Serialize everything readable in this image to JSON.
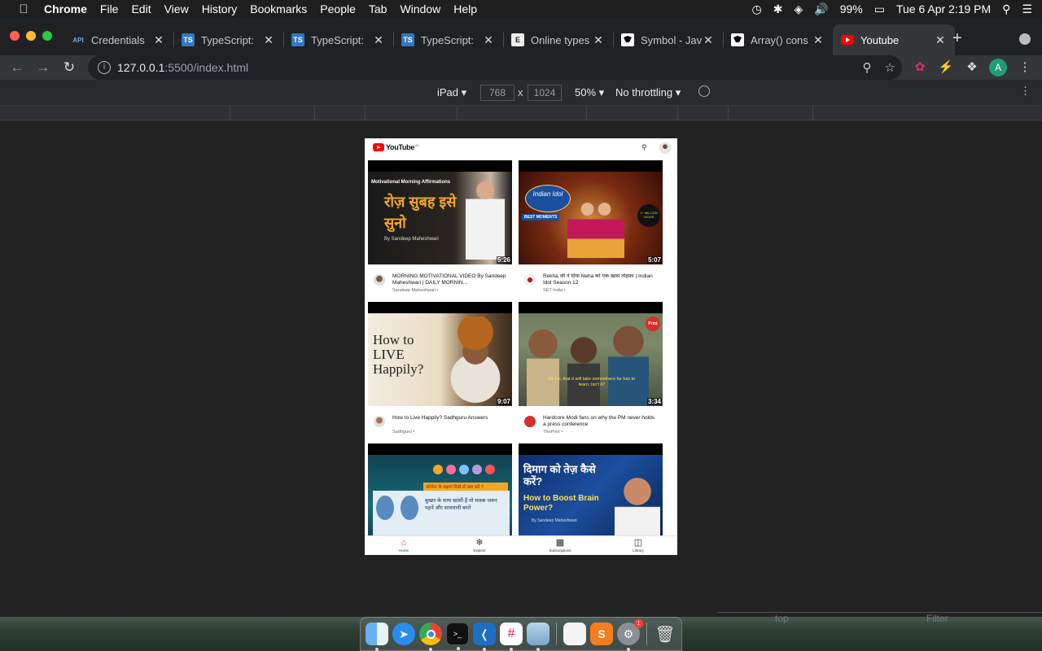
{
  "menubar": {
    "app": "Chrome",
    "items": [
      "File",
      "Edit",
      "View",
      "History",
      "Bookmarks",
      "People",
      "Tab",
      "Window",
      "Help"
    ],
    "battery": "99%",
    "datetime": "Tue 6 Apr  2:19 PM"
  },
  "tabs": [
    {
      "title": "Credentials",
      "fav": "API"
    },
    {
      "title": "TypeScript:",
      "fav": "TS"
    },
    {
      "title": "TypeScript:",
      "fav": "TS"
    },
    {
      "title": "TypeScript:",
      "fav": "TS"
    },
    {
      "title": "Online types",
      "fav": "E"
    },
    {
      "title": "Symbol - Jav",
      "fav": ""
    },
    {
      "title": "Array() cons",
      "fav": ""
    },
    {
      "title": "Youtube",
      "fav": "yt"
    }
  ],
  "address": {
    "host": "127.0.0.1",
    "rest": ":5500/index.html"
  },
  "device_toolbar": {
    "device": "iPad ▾",
    "width": "768",
    "height": "1024",
    "zoom": "50% ▾",
    "throttle": "No throttling ▾"
  },
  "youtube": {
    "logo": "YouTube",
    "logo_super": "IN",
    "videos": [
      {
        "title": "MORNING MOTIVATIONAL VIDEO By Sandeep Maheshwari | DAILY MORNIN...",
        "channel": "Sandeep Maheshwari •",
        "duration": "5:26"
      },
      {
        "title": "Rekha जी ने दिया Neha को एक ख़ास तोहफ़ा | Indian Idol Season 12",
        "channel": "SET India •",
        "duration": "5:07"
      },
      {
        "title": "How to Live Happily? Sadhguru Answers",
        "channel": "Sadhguru •",
        "duration": "9:07"
      },
      {
        "title": "Hardcore Modi fans on why the PM never holds a press conference",
        "channel": "ThePrint •",
        "duration": "3:34"
      },
      {
        "title": "",
        "channel": "",
        "duration": ""
      },
      {
        "title": "",
        "channel": "",
        "duration": ""
      }
    ],
    "thumb_text": {
      "t1_top": "Motivational Morning Affirmations",
      "t1_main": "रोज़ सुबह इसे सुनो",
      "t1_by": "By Sandeep Maheshwari",
      "t2_a": "Indian Idol",
      "t2_b": "BEST MOMENTS",
      "t2_c": "1+ MILLION VIEWS",
      "t3": "How to LIVE Happily?",
      "t4_cap": "No no, that it will take somewhere he has to learn. Isn't it?",
      "t4_logo": "Print",
      "t5_hdr": "कोरोना के लक्षण दिखें तो क्या करें ?",
      "t5_line": "बुखार के साथ खांसी है तो मास्क जरूर पहनें और सावधानी बरतें",
      "t6_hin": "दिमाग को तेज़ कैसे करें?",
      "t6_en": "How to Boost Brain Power?",
      "t6_by": "By Sandeep Maheshwari"
    },
    "bottom_nav": [
      {
        "label": "Home",
        "icon": "home-icon"
      },
      {
        "label": "Explore",
        "icon": "explore-icon"
      },
      {
        "label": "Subscriptions",
        "icon": "subscriptions-icon"
      },
      {
        "label": "Library",
        "icon": "library-icon"
      }
    ]
  },
  "devtools_ghost": {
    "context": "top",
    "filter": "Filter"
  },
  "colors": {
    "yt_red": "#ff0000",
    "chrome_dark": "#202124",
    "active_tab": "#35363a"
  }
}
